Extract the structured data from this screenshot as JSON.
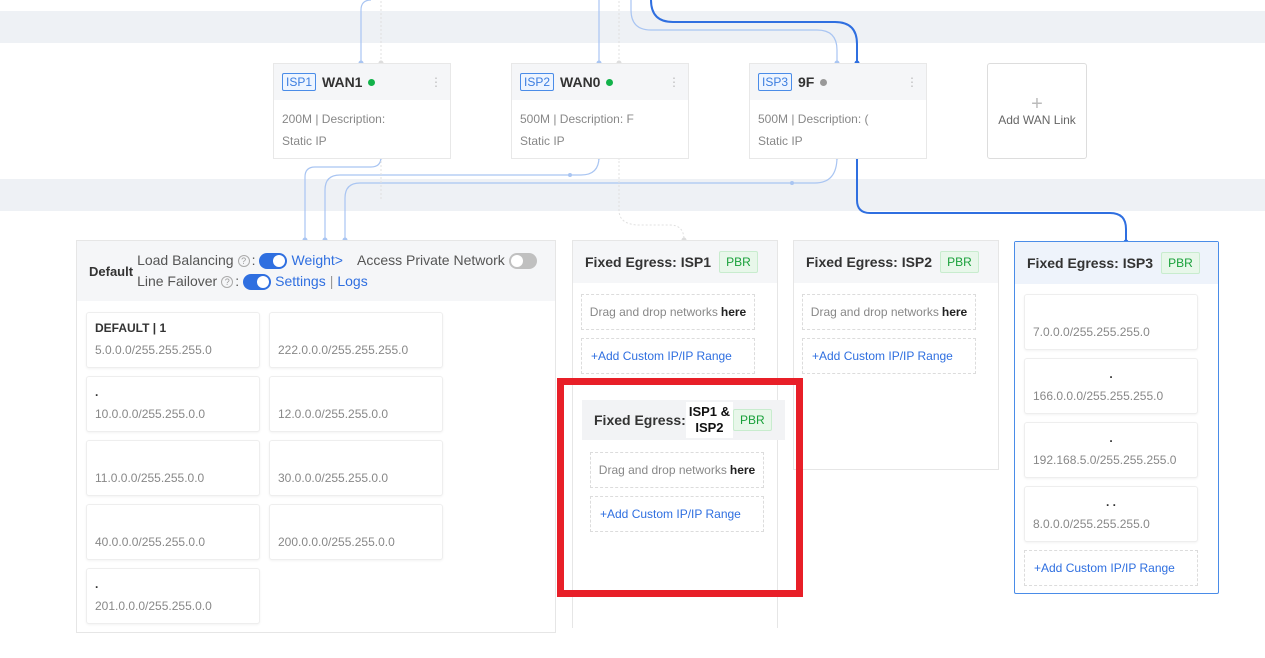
{
  "wan_links": [
    {
      "isp": "ISP1",
      "name": "WAN1",
      "status": "online",
      "bandwidth_desc": "200M | Description:",
      "ip_type": "Static IP"
    },
    {
      "isp": "ISP2",
      "name": "WAN0",
      "status": "online",
      "bandwidth_desc": "500M | Description: F",
      "ip_type": "Static IP"
    },
    {
      "isp": "ISP3",
      "name": "9F",
      "status": "offline",
      "bandwidth_desc": "500M | Description: (",
      "ip_type": "Static IP"
    }
  ],
  "add_wan": {
    "label": "Add WAN Link",
    "plus": "+"
  },
  "default_group": {
    "title": "Default",
    "load_balancing_label": "Load Balancing",
    "weight_link": "Weight>",
    "access_private_label": "Access Private Network",
    "line_failover_label": "Line Failover",
    "settings_link": "Settings",
    "separator": "|",
    "logs_link": "Logs",
    "help": "?",
    "networks": [
      {
        "name": "DEFAULT | 1",
        "ip": "5.0.0.0/255.255.255.0"
      },
      {
        "name": "",
        "ip": "222.0.0.0/255.255.255.0"
      },
      {
        "name": ".",
        "ip": "10.0.0.0/255.255.0.0"
      },
      {
        "name": "",
        "ip": "12.0.0.0/255.255.0.0"
      },
      {
        "name": "",
        "ip": "11.0.0.0/255.255.0.0"
      },
      {
        "name": "",
        "ip": "30.0.0.0/255.255.0.0"
      },
      {
        "name": "",
        "ip": "40.0.0.0/255.255.0.0"
      },
      {
        "name": "",
        "ip": "200.0.0.0/255.255.0.0"
      },
      {
        "name": ".",
        "ip": "201.0.0.0/255.255.0.0"
      }
    ]
  },
  "fixed_egress": [
    {
      "title": "Fixed Egress: ISP1",
      "badge": "PBR",
      "drop_text": "Drag and drop networks",
      "drop_bold": "here",
      "add_label": "+Add Custom IP/IP Range"
    },
    {
      "title": "Fixed Egress: ISP2",
      "badge": "PBR",
      "drop_text": "Drag and drop networks",
      "drop_bold": "here",
      "add_label": "+Add Custom IP/IP Range"
    },
    {
      "title": "Fixed Egress: ISP3",
      "badge": "PBR",
      "add_label": "+Add Custom IP/IP Range",
      "networks": [
        {
          "name": "",
          "ip": "7.0.0.0/255.255.255.0"
        },
        {
          "name": ".",
          "ip": "166.0.0.0/255.255.255.0"
        },
        {
          "name": ".",
          "ip": "192.168.5.0/255.255.255.0"
        },
        {
          "name": ". .",
          "ip": "8.0.0.0/255.255.255.0"
        }
      ]
    }
  ],
  "combo_egress": {
    "title": "Fixed Egress:",
    "isp_line1": "ISP1 &",
    "isp_line2": "ISP2",
    "badge": "PBR",
    "drop_text": "Drag and drop networks",
    "drop_bold": "here",
    "add_label": "+Add Custom IP/IP Range"
  },
  "colors": {
    "accent": "#2f6fe0",
    "online": "#12b24a",
    "offline": "#999999",
    "highlight": "#e81f28",
    "pbr": "#19a03a"
  },
  "icons": {
    "kebab": "⋮"
  }
}
